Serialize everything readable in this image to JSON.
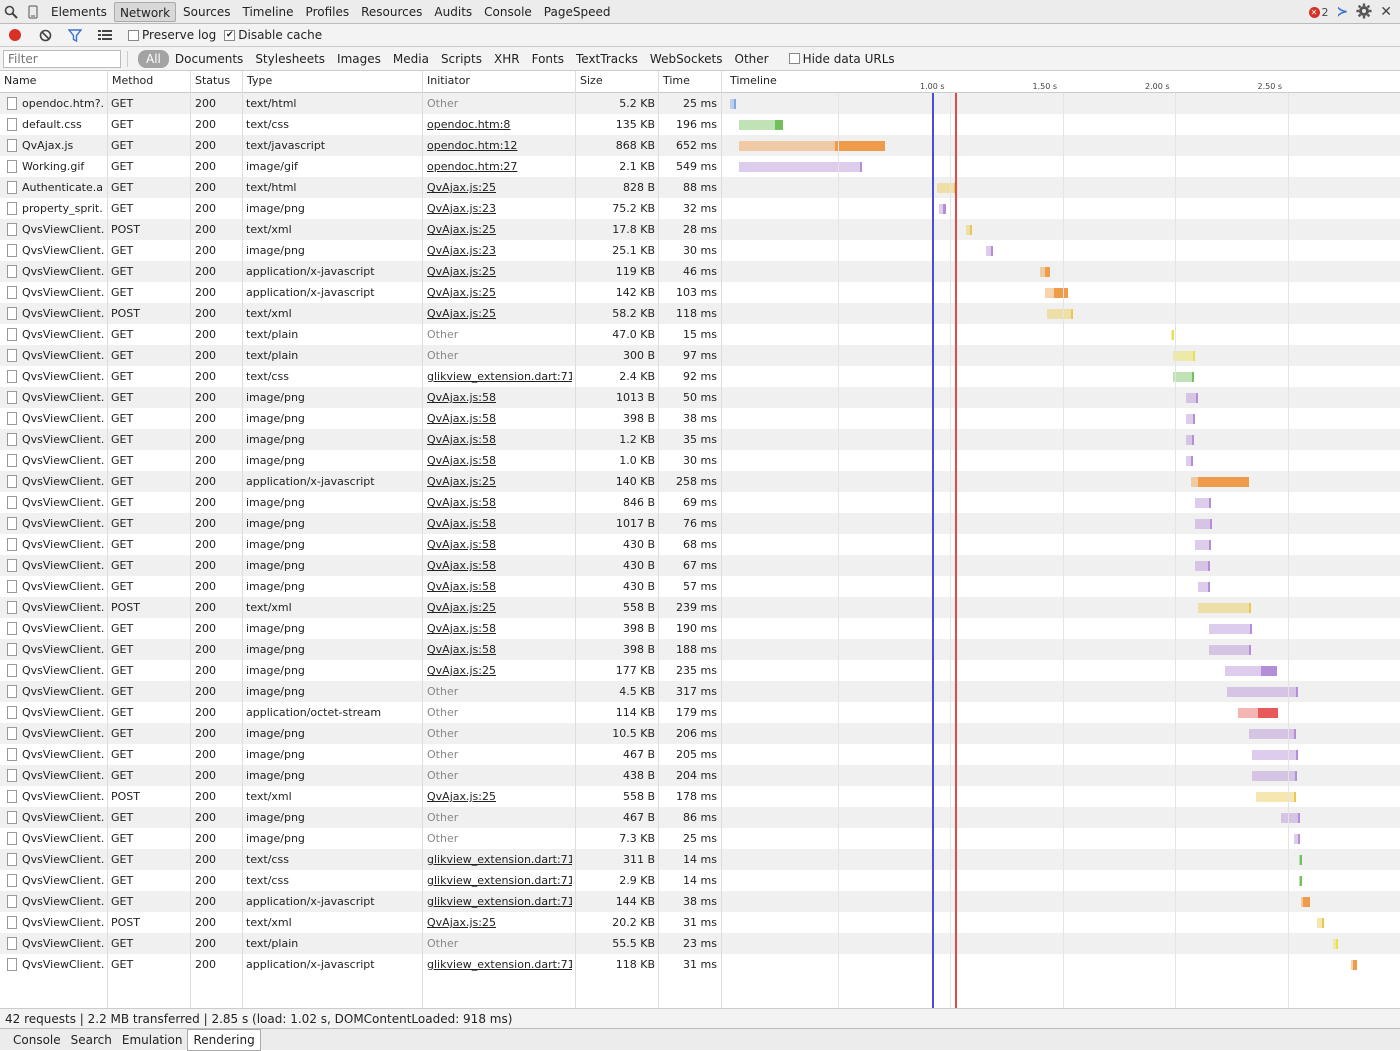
{
  "toolbar": {
    "tabs": [
      "Elements",
      "Network",
      "Sources",
      "Timeline",
      "Profiles",
      "Resources",
      "Audits",
      "Console",
      "PageSpeed"
    ],
    "selected_tab": "Network",
    "error_count": "2"
  },
  "options": {
    "preserve_log": "Preserve log",
    "preserve_log_checked": false,
    "disable_cache": "Disable cache",
    "disable_cache_checked": true
  },
  "filterbar": {
    "placeholder": "Filter",
    "types": [
      "All",
      "Documents",
      "Stylesheets",
      "Images",
      "Media",
      "Scripts",
      "XHR",
      "Fonts",
      "TextTracks",
      "WebSockets",
      "Other"
    ],
    "selected": "All",
    "hide_data_urls": "Hide data URLs"
  },
  "columns": {
    "name": "Name",
    "method": "Method",
    "status": "Status",
    "type": "Type",
    "initiator": "Initiator",
    "size": "Size",
    "time": "Time",
    "timeline": "Timeline"
  },
  "timeline": {
    "ticks": [
      "1.00 s",
      "1.50 s",
      "2.00 s",
      "2.50 s"
    ],
    "dom_content_loaded_s": 0.918,
    "load_s": 1.02,
    "colors": {
      "document": "#7fa7e3",
      "stylesheet": "#72c05b",
      "script": "#ef9b4a",
      "image": "#b58ed8",
      "xhr": "#e8c94e",
      "other": "#e9e04e",
      "font": "#e85a5a"
    }
  },
  "requests": [
    {
      "name": "opendoc.htm?...",
      "method": "GET",
      "status": "200",
      "type": "text/html",
      "initiator": "Other",
      "link": false,
      "size": "5.2 KB",
      "time": "25 ms",
      "start": 0.02,
      "wait": 0.025,
      "recv": 0.005,
      "kind": "document"
    },
    {
      "name": "default.css",
      "method": "GET",
      "status": "200",
      "type": "text/css",
      "initiator": "opendoc.htm:8",
      "link": true,
      "size": "135 KB",
      "time": "196 ms",
      "start": 0.06,
      "wait": 0.16,
      "recv": 0.036,
      "kind": "stylesheet"
    },
    {
      "name": "QvAjax.js",
      "method": "GET",
      "status": "200",
      "type": "text/javascript",
      "initiator": "opendoc.htm:12",
      "link": true,
      "size": "868 KB",
      "time": "652 ms",
      "start": 0.06,
      "wait": 0.43,
      "recv": 0.22,
      "kind": "script"
    },
    {
      "name": "Working.gif",
      "method": "GET",
      "status": "200",
      "type": "image/gif",
      "initiator": "opendoc.htm:27",
      "link": true,
      "size": "2.1 KB",
      "time": "549 ms",
      "start": 0.06,
      "wait": 0.54,
      "recv": 0.009,
      "kind": "image"
    },
    {
      "name": "Authenticate.a...",
      "method": "GET",
      "status": "200",
      "type": "text/html",
      "initiator": "QvAjax.js:25",
      "link": true,
      "size": "828 B",
      "time": "88 ms",
      "start": 0.94,
      "wait": 0.08,
      "recv": 0.008,
      "kind": "xhr"
    },
    {
      "name": "property_sprit...",
      "method": "GET",
      "status": "200",
      "type": "image/png",
      "initiator": "QvAjax.js:23",
      "link": true,
      "size": "75.2 KB",
      "time": "32 ms",
      "start": 0.95,
      "wait": 0.02,
      "recv": 0.012,
      "kind": "image"
    },
    {
      "name": "QvsViewClient...",
      "method": "POST",
      "status": "200",
      "type": "text/xml",
      "initiator": "QvAjax.js:25",
      "link": true,
      "size": "17.8 KB",
      "time": "28 ms",
      "start": 1.07,
      "wait": 0.02,
      "recv": 0.008,
      "kind": "xhr"
    },
    {
      "name": "QvsViewClient...",
      "method": "GET",
      "status": "200",
      "type": "image/png",
      "initiator": "QvAjax.js:23",
      "link": true,
      "size": "25.1 KB",
      "time": "30 ms",
      "start": 1.16,
      "wait": 0.02,
      "recv": 0.01,
      "kind": "image"
    },
    {
      "name": "QvsViewClient...",
      "method": "GET",
      "status": "200",
      "type": "application/x-javascript",
      "initiator": "QvAjax.js:25",
      "link": true,
      "size": "119 KB",
      "time": "46 ms",
      "start": 1.4,
      "wait": 0.02,
      "recv": 0.026,
      "kind": "script"
    },
    {
      "name": "QvsViewClient...",
      "method": "GET",
      "status": "200",
      "type": "application/x-javascript",
      "initiator": "QvAjax.js:25",
      "link": true,
      "size": "142 KB",
      "time": "103 ms",
      "start": 1.42,
      "wait": 0.04,
      "recv": 0.063,
      "kind": "script"
    },
    {
      "name": "QvsViewClient...",
      "method": "POST",
      "status": "200",
      "type": "text/xml",
      "initiator": "QvAjax.js:25",
      "link": true,
      "size": "58.2 KB",
      "time": "118 ms",
      "start": 1.43,
      "wait": 0.11,
      "recv": 0.008,
      "kind": "xhr"
    },
    {
      "name": "QvsViewClient...",
      "method": "GET",
      "status": "200",
      "type": "text/plain",
      "initiator": "Other",
      "link": false,
      "size": "47.0 KB",
      "time": "15 ms",
      "start": 1.98,
      "wait": 0.01,
      "recv": 0.005,
      "kind": "other"
    },
    {
      "name": "QvsViewClient...",
      "method": "GET",
      "status": "200",
      "type": "text/plain",
      "initiator": "Other",
      "link": false,
      "size": "300 B",
      "time": "97 ms",
      "start": 1.99,
      "wait": 0.09,
      "recv": 0.007,
      "kind": "other"
    },
    {
      "name": "QvsViewClient...",
      "method": "GET",
      "status": "200",
      "type": "text/css",
      "initiator": "glikview_extension.dart:71",
      "link": true,
      "size": "2.4 KB",
      "time": "92 ms",
      "start": 1.99,
      "wait": 0.09,
      "recv": 0.004,
      "kind": "stylesheet"
    },
    {
      "name": "QvsViewClient...",
      "method": "GET",
      "status": "200",
      "type": "image/png",
      "initiator": "QvAjax.js:58",
      "link": true,
      "size": "1013 B",
      "time": "50 ms",
      "start": 2.05,
      "wait": 0.045,
      "recv": 0.005,
      "kind": "image"
    },
    {
      "name": "QvsViewClient...",
      "method": "GET",
      "status": "200",
      "type": "image/png",
      "initiator": "QvAjax.js:58",
      "link": true,
      "size": "398 B",
      "time": "38 ms",
      "start": 2.05,
      "wait": 0.034,
      "recv": 0.004,
      "kind": "image"
    },
    {
      "name": "QvsViewClient...",
      "method": "GET",
      "status": "200",
      "type": "image/png",
      "initiator": "QvAjax.js:58",
      "link": true,
      "size": "1.2 KB",
      "time": "35 ms",
      "start": 2.05,
      "wait": 0.031,
      "recv": 0.004,
      "kind": "image"
    },
    {
      "name": "QvsViewClient...",
      "method": "GET",
      "status": "200",
      "type": "image/png",
      "initiator": "QvAjax.js:58",
      "link": true,
      "size": "1.0 KB",
      "time": "30 ms",
      "start": 2.05,
      "wait": 0.026,
      "recv": 0.004,
      "kind": "image"
    },
    {
      "name": "QvsViewClient...",
      "method": "GET",
      "status": "200",
      "type": "application/x-javascript",
      "initiator": "QvAjax.js:25",
      "link": true,
      "size": "140 KB",
      "time": "258 ms",
      "start": 2.07,
      "wait": 0.03,
      "recv": 0.228,
      "kind": "script"
    },
    {
      "name": "QvsViewClient...",
      "method": "GET",
      "status": "200",
      "type": "image/png",
      "initiator": "QvAjax.js:58",
      "link": true,
      "size": "846 B",
      "time": "69 ms",
      "start": 2.09,
      "wait": 0.063,
      "recv": 0.006,
      "kind": "image"
    },
    {
      "name": "QvsViewClient...",
      "method": "GET",
      "status": "200",
      "type": "image/png",
      "initiator": "QvAjax.js:58",
      "link": true,
      "size": "1017 B",
      "time": "76 ms",
      "start": 2.09,
      "wait": 0.07,
      "recv": 0.006,
      "kind": "image"
    },
    {
      "name": "QvsViewClient...",
      "method": "GET",
      "status": "200",
      "type": "image/png",
      "initiator": "QvAjax.js:58",
      "link": true,
      "size": "430 B",
      "time": "68 ms",
      "start": 2.09,
      "wait": 0.062,
      "recv": 0.006,
      "kind": "image"
    },
    {
      "name": "QvsViewClient...",
      "method": "GET",
      "status": "200",
      "type": "image/png",
      "initiator": "QvAjax.js:58",
      "link": true,
      "size": "430 B",
      "time": "67 ms",
      "start": 2.09,
      "wait": 0.061,
      "recv": 0.006,
      "kind": "image"
    },
    {
      "name": "QvsViewClient...",
      "method": "GET",
      "status": "200",
      "type": "image/png",
      "initiator": "QvAjax.js:58",
      "link": true,
      "size": "430 B",
      "time": "57 ms",
      "start": 2.1,
      "wait": 0.051,
      "recv": 0.006,
      "kind": "image"
    },
    {
      "name": "QvsViewClient...",
      "method": "POST",
      "status": "200",
      "type": "text/xml",
      "initiator": "QvAjax.js:25",
      "link": true,
      "size": "558 B",
      "time": "239 ms",
      "start": 2.1,
      "wait": 0.231,
      "recv": 0.008,
      "kind": "xhr"
    },
    {
      "name": "QvsViewClient...",
      "method": "GET",
      "status": "200",
      "type": "image/png",
      "initiator": "QvAjax.js:58",
      "link": true,
      "size": "398 B",
      "time": "190 ms",
      "start": 2.15,
      "wait": 0.184,
      "recv": 0.006,
      "kind": "image"
    },
    {
      "name": "QvsViewClient...",
      "method": "GET",
      "status": "200",
      "type": "image/png",
      "initiator": "QvAjax.js:58",
      "link": true,
      "size": "398 B",
      "time": "188 ms",
      "start": 2.15,
      "wait": 0.182,
      "recv": 0.006,
      "kind": "image"
    },
    {
      "name": "QvsViewClient...",
      "method": "GET",
      "status": "200",
      "type": "image/png",
      "initiator": "QvAjax.js:25",
      "link": true,
      "size": "177 KB",
      "time": "235 ms",
      "start": 2.22,
      "wait": 0.16,
      "recv": 0.075,
      "kind": "image"
    },
    {
      "name": "QvsViewClient...",
      "method": "GET",
      "status": "200",
      "type": "image/png",
      "initiator": "Other",
      "link": false,
      "size": "4.5 KB",
      "time": "317 ms",
      "start": 2.23,
      "wait": 0.311,
      "recv": 0.006,
      "kind": "image"
    },
    {
      "name": "QvsViewClient...",
      "method": "GET",
      "status": "200",
      "type": "application/octet-stream",
      "initiator": "Other",
      "link": false,
      "size": "114 KB",
      "time": "179 ms",
      "start": 2.28,
      "wait": 0.09,
      "recv": 0.089,
      "kind": "font"
    },
    {
      "name": "QvsViewClient...",
      "method": "GET",
      "status": "200",
      "type": "image/png",
      "initiator": "Other",
      "link": false,
      "size": "10.5 KB",
      "time": "206 ms",
      "start": 2.33,
      "wait": 0.2,
      "recv": 0.006,
      "kind": "image"
    },
    {
      "name": "QvsViewClient...",
      "method": "GET",
      "status": "200",
      "type": "image/png",
      "initiator": "Other",
      "link": false,
      "size": "467 B",
      "time": "205 ms",
      "start": 2.34,
      "wait": 0.199,
      "recv": 0.006,
      "kind": "image"
    },
    {
      "name": "QvsViewClient...",
      "method": "GET",
      "status": "200",
      "type": "image/png",
      "initiator": "Other",
      "link": false,
      "size": "438 B",
      "time": "204 ms",
      "start": 2.34,
      "wait": 0.198,
      "recv": 0.006,
      "kind": "image"
    },
    {
      "name": "QvsViewClient...",
      "method": "POST",
      "status": "200",
      "type": "text/xml",
      "initiator": "QvAjax.js:25",
      "link": true,
      "size": "558 B",
      "time": "178 ms",
      "start": 2.36,
      "wait": 0.17,
      "recv": 0.008,
      "kind": "xhr"
    },
    {
      "name": "QvsViewClient...",
      "method": "GET",
      "status": "200",
      "type": "image/png",
      "initiator": "Other",
      "link": false,
      "size": "467 B",
      "time": "86 ms",
      "start": 2.47,
      "wait": 0.08,
      "recv": 0.006,
      "kind": "image"
    },
    {
      "name": "QvsViewClient...",
      "method": "GET",
      "status": "200",
      "type": "image/png",
      "initiator": "Other",
      "link": false,
      "size": "7.3 KB",
      "time": "25 ms",
      "start": 2.53,
      "wait": 0.02,
      "recv": 0.005,
      "kind": "image"
    },
    {
      "name": "QvsViewClient...",
      "method": "GET",
      "status": "200",
      "type": "text/css",
      "initiator": "glikview_extension.dart:71",
      "link": true,
      "size": "311 B",
      "time": "14 ms",
      "start": 2.55,
      "wait": 0.01,
      "recv": 0.004,
      "kind": "stylesheet"
    },
    {
      "name": "QvsViewClient...",
      "method": "GET",
      "status": "200",
      "type": "text/css",
      "initiator": "glikview_extension.dart:71",
      "link": true,
      "size": "2.9 KB",
      "time": "14 ms",
      "start": 2.55,
      "wait": 0.01,
      "recv": 0.004,
      "kind": "stylesheet"
    },
    {
      "name": "QvsViewClient...",
      "method": "GET",
      "status": "200",
      "type": "application/x-javascript",
      "initiator": "glikview_extension.dart:71",
      "link": true,
      "size": "144 KB",
      "time": "38 ms",
      "start": 2.56,
      "wait": 0.01,
      "recv": 0.028,
      "kind": "script"
    },
    {
      "name": "QvsViewClient...",
      "method": "POST",
      "status": "200",
      "type": "text/xml",
      "initiator": "QvAjax.js:25",
      "link": true,
      "size": "20.2 KB",
      "time": "31 ms",
      "start": 2.63,
      "wait": 0.023,
      "recv": 0.008,
      "kind": "xhr"
    },
    {
      "name": "QvsViewClient...",
      "method": "GET",
      "status": "200",
      "type": "text/plain",
      "initiator": "Other",
      "link": false,
      "size": "55.5 KB",
      "time": "23 ms",
      "start": 2.7,
      "wait": 0.018,
      "recv": 0.005,
      "kind": "other"
    },
    {
      "name": "QvsViewClient...",
      "method": "GET",
      "status": "200",
      "type": "application/x-javascript",
      "initiator": "glikview_extension.dart:71",
      "link": true,
      "size": "118 KB",
      "time": "31 ms",
      "start": 2.78,
      "wait": 0.01,
      "recv": 0.021,
      "kind": "script"
    }
  ],
  "status_text": "42 requests | 2.2 MB transferred | 2.85 s (load: 1.02 s, DOMContentLoaded: 918 ms)",
  "drawer": {
    "tabs": [
      "Console",
      "Search",
      "Emulation",
      "Rendering"
    ],
    "selected": "Rendering"
  }
}
